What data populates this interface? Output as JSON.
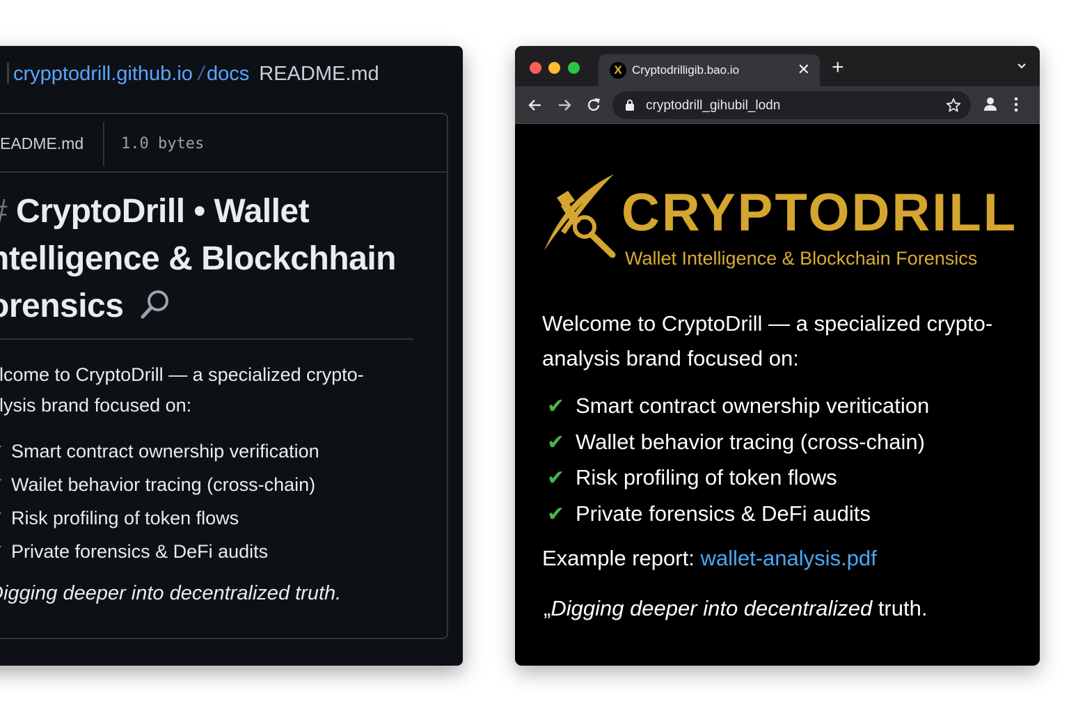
{
  "left_panel": {
    "breadcrumb": {
      "repo": "crypptodrill.github.io",
      "separator": "/",
      "folder": "docs",
      "file": "README.md"
    },
    "file_header": {
      "name": "EADME.md",
      "size": "1.0  bytes"
    },
    "readme": {
      "heading_hash": "#",
      "heading_text": "CryptoDrill • Wallet ntelligence & Blockchhain orensics",
      "intro": "elcome to CryptoDrill — a specialized crypto- alysis brand focused on:",
      "check_glyph": "✓",
      "items": [
        "Smart contract ownership verification",
        "Wailet behavior tracing (cross-chain)",
        "Risk profiling of token flows",
        "Private forensics & DeFi audits"
      ],
      "quote": "Digging deeper into decentralized truth."
    }
  },
  "browser": {
    "tab": {
      "favicon": "X",
      "title": "Cryptodrilligib.bao.io"
    },
    "address_bar": {
      "url": "cryptodrill_gihubil_lodn"
    },
    "icons": {
      "close": "close-icon",
      "new_tab": "plus-icon",
      "tab_menu": "chevron-down-icon",
      "back": "arrow-left-icon",
      "forward": "arrow-right-icon",
      "reload": "reload-icon",
      "lock": "lock-icon",
      "bookmark": "star-icon",
      "profile": "person-icon",
      "menu": "kebab-menu-icon"
    },
    "page": {
      "brand": "CRYPTODRILL",
      "tagline": "Wallet Intelligence & Blockchain Forensics",
      "intro": "Welcome to CryptoDrill — a specialized crypto- analysis brand focused on:",
      "check_glyph": "✔",
      "features": [
        "Smart contract ownership veritication",
        "Wallet behavior tracing (cross-chain)",
        "Risk profiling of token flows",
        "Private forensics & DeFi audits"
      ],
      "report_label": "Example report:",
      "report_link": "wallet-analysis.pdf",
      "quote_mark": "„",
      "quote_italic": "Digging deeper into decentralized",
      "quote_rest": " truth."
    }
  },
  "colors": {
    "brand_gold": "#d4a62f",
    "link_blue": "#4aa8f5",
    "check_green": "#4cb34c",
    "github_link": "#58a6ff",
    "left_bg": "#0d1015",
    "browser_chrome": "#35363a"
  }
}
